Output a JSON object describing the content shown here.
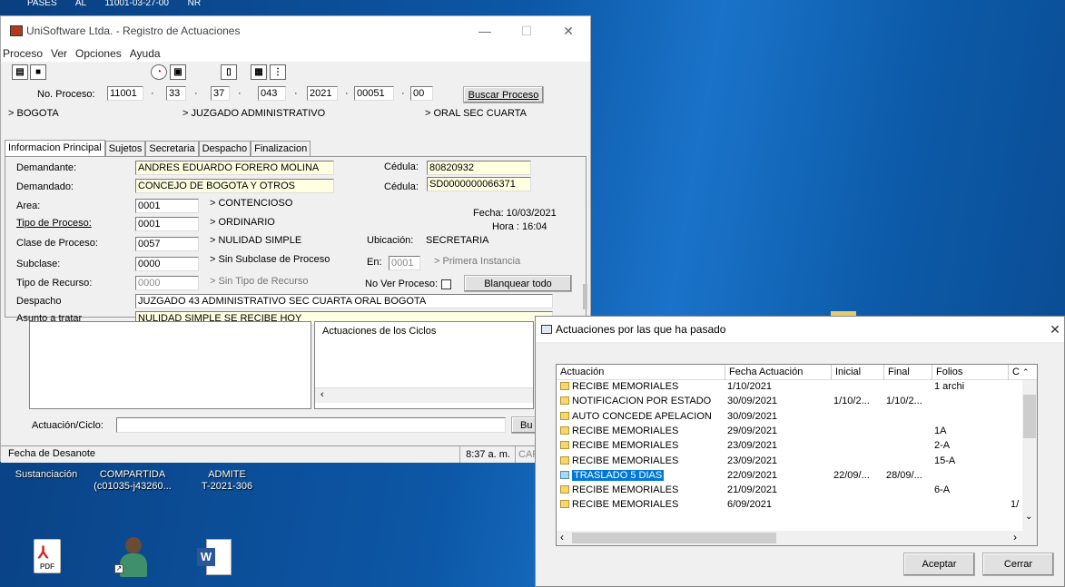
{
  "desktop": {
    "top_strip": "PASES AL 11001-03-27-00 NR",
    "icons": [
      {
        "label_l1": "Sustanciación",
        "label_l2": ""
      },
      {
        "label_l1": "COMPARTIDA",
        "label_l2": "(c01035-j43260..."
      },
      {
        "label_l1": "ADMITE",
        "label_l2": "T-2021-306"
      }
    ],
    "bottom_icons": [
      {
        "icon": "pdf-icon",
        "label": "PDF"
      },
      {
        "icon": "user-shortcut-icon"
      },
      {
        "icon": "word-icon",
        "label": "W"
      }
    ]
  },
  "main": {
    "title": "UniSoftware Ltda. - Registro de Actuaciones",
    "controls": {
      "minimize": "—",
      "maximize": "☐",
      "close": "✕"
    },
    "menu": [
      "Proceso",
      "Ver",
      "Opciones",
      "Ayuda"
    ],
    "proceso": {
      "label": "No. Proceso:",
      "parts": [
        "11001",
        "33",
        "37",
        "043",
        "2021",
        "00051",
        "00"
      ],
      "sep": "·",
      "search_button": "Buscar Proceso"
    },
    "locations": {
      "city": "> BOGOTA",
      "court": "> JUZGADO ADMINISTRATIVO",
      "section": "> ORAL SEC CUARTA"
    },
    "tabs": [
      "Informacion Principal",
      "Sujetos",
      "Secretaria",
      "Despacho",
      "Finalizacion"
    ],
    "form": {
      "demandante_label": "Demandante:",
      "demandante": "ANDRES EDUARDO FORERO MOLINA",
      "cedula_label": "Cédula:",
      "cedula1": "80820932",
      "demandado_label": "Demandado:",
      "demandado": "CONCEJO DE BOGOTA Y OTROS",
      "cedula2": "SD0000000066371",
      "area_label": "Area:",
      "area": "0001",
      "area_desc": "> CONTENCIOSO",
      "fecha": "Fecha: 10/03/2021",
      "hora": "Hora :  16:04",
      "tipo_label": "Tipo de Proceso:",
      "tipo": "0001",
      "tipo_desc": "> ORDINARIO",
      "clase_label": "Clase de Proceso:",
      "clase": "0057",
      "clase_desc": "> NULIDAD SIMPLE",
      "ubicacion_label": "Ubicación:",
      "ubicacion": "SECRETARIA",
      "subclase_label": "Subclase:",
      "subclase": "0000",
      "subclase_desc": "> Sin Subclase de Proceso",
      "en_label": "En:",
      "en": "0001",
      "en_desc": "> Primera Instancia",
      "recurso_label": "Tipo de Recurso:",
      "recurso": "0000",
      "recurso_desc": "> Sin Tipo de Recurso",
      "nover_label": "No Ver Proceso:",
      "blanquear": "Blanquear todo",
      "despacho_label": "Despacho",
      "despacho": "JUZGADO 43 ADMINISTRATIVO SEC CUARTA ORAL BOGOTA",
      "asunto_label": "Asunto a tratar",
      "asunto": "NULIDAD SIMPLE SE RECIBE HOY"
    },
    "ciclos_header": "Actuaciones de los Ciclos",
    "actuacion_label": "Actuación/Ciclo:",
    "actuacion_btn": "Bu",
    "status": {
      "left": "Fecha de Desanote",
      "time": "8:37 a. m.",
      "caps": "CAP"
    }
  },
  "dialog": {
    "title": "Actuaciones por las que ha pasado",
    "close": "✕",
    "columns": [
      "Actuación",
      "Fecha Actuación",
      "Inicial",
      "Final",
      "Folios",
      "C"
    ],
    "rows": [
      {
        "a": "RECIBE MEMORIALES",
        "f": "1/10/2021",
        "i": "",
        "fi": "",
        "fo": "1 archi",
        "c": ""
      },
      {
        "a": "NOTIFICACION POR ESTADO",
        "f": "30/09/2021",
        "i": "1/10/2...",
        "fi": "1/10/2...",
        "fo": "",
        "c": ""
      },
      {
        "a": "AUTO CONCEDE APELACION",
        "f": "30/09/2021",
        "i": "",
        "fi": "",
        "fo": "",
        "c": ""
      },
      {
        "a": "RECIBE MEMORIALES",
        "f": "29/09/2021",
        "i": "",
        "fi": "",
        "fo": "1A",
        "c": ""
      },
      {
        "a": "RECIBE MEMORIALES",
        "f": "23/09/2021",
        "i": "",
        "fi": "",
        "fo": "2-A",
        "c": ""
      },
      {
        "a": "RECIBE MEMORIALES",
        "f": "23/09/2021",
        "i": "",
        "fi": "",
        "fo": "15-A",
        "c": ""
      },
      {
        "a": "TRASLADO 5 DIAS",
        "f": "22/09/2021",
        "i": "22/09/...",
        "fi": "28/09/...",
        "fo": "",
        "c": "",
        "selected": true
      },
      {
        "a": "RECIBE MEMORIALES",
        "f": "21/09/2021",
        "i": "",
        "fi": "",
        "fo": "6-A",
        "c": ""
      },
      {
        "a": "RECIBE MEMORIALES",
        "f": "6/09/2021",
        "i": "",
        "fi": "",
        "fo": "",
        "c": "1/"
      }
    ],
    "accept": "Aceptar",
    "close_btn": "Cerrar"
  }
}
